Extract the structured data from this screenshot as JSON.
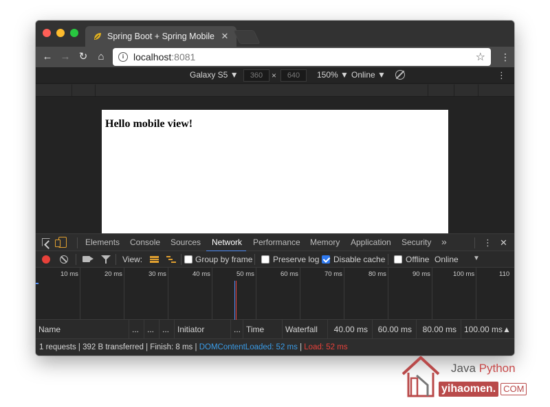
{
  "browser": {
    "tab_title": "Spring Boot + Spring Mobile S",
    "url_host": "localhost",
    "url_port": ":8081"
  },
  "device_toolbar": {
    "device": "Galaxy S5 ▼",
    "width": "360",
    "times": "×",
    "height": "640",
    "zoom": "150% ▼",
    "throttle": "Online ▼"
  },
  "page": {
    "heading": "Hello mobile view!"
  },
  "devtools": {
    "tabs": [
      "Elements",
      "Console",
      "Sources",
      "Network",
      "Performance",
      "Memory",
      "Application",
      "Security"
    ],
    "active_tab": "Network",
    "more": "»",
    "menu": "⋮",
    "close": "✕"
  },
  "network_toolbar": {
    "view_label": "View:",
    "group_by_frame": "Group by frame",
    "preserve_log": "Preserve log",
    "disable_cache": "Disable cache",
    "offline": "Offline",
    "throttle": "Online"
  },
  "overview_ticks": [
    "10 ms",
    "20 ms",
    "30 ms",
    "40 ms",
    "50 ms",
    "60 ms",
    "70 ms",
    "80 ms",
    "90 ms",
    "100 ms",
    "110"
  ],
  "table_columns": {
    "name": "Name",
    "c2": "...",
    "c3": "...",
    "c4": "...",
    "initiator": "Initiator",
    "c6": "...",
    "time": "Time",
    "waterfall": "Waterfall",
    "t1": "40.00 ms",
    "t2": "60.00 ms",
    "t3": "80.00 ms",
    "t4": "100.00 ms▲"
  },
  "status_bar": {
    "summary": "1 requests | 392 B transferred | Finish: 8 ms | ",
    "dom_content_loaded": "DOMContentLoaded: 52 ms",
    "separator": " | ",
    "load": "Load: 52 ms"
  },
  "watermark": {
    "java": "Java ",
    "python": "Python",
    "domain": "yihaomen.",
    "tld": "COM"
  },
  "colors": {
    "accent_blue": "#4f8df5",
    "record_red": "#e8413a",
    "devtools_orange": "#e0a030",
    "dom_loaded_blue": "#3a9ce8",
    "load_red": "#e8413a"
  }
}
